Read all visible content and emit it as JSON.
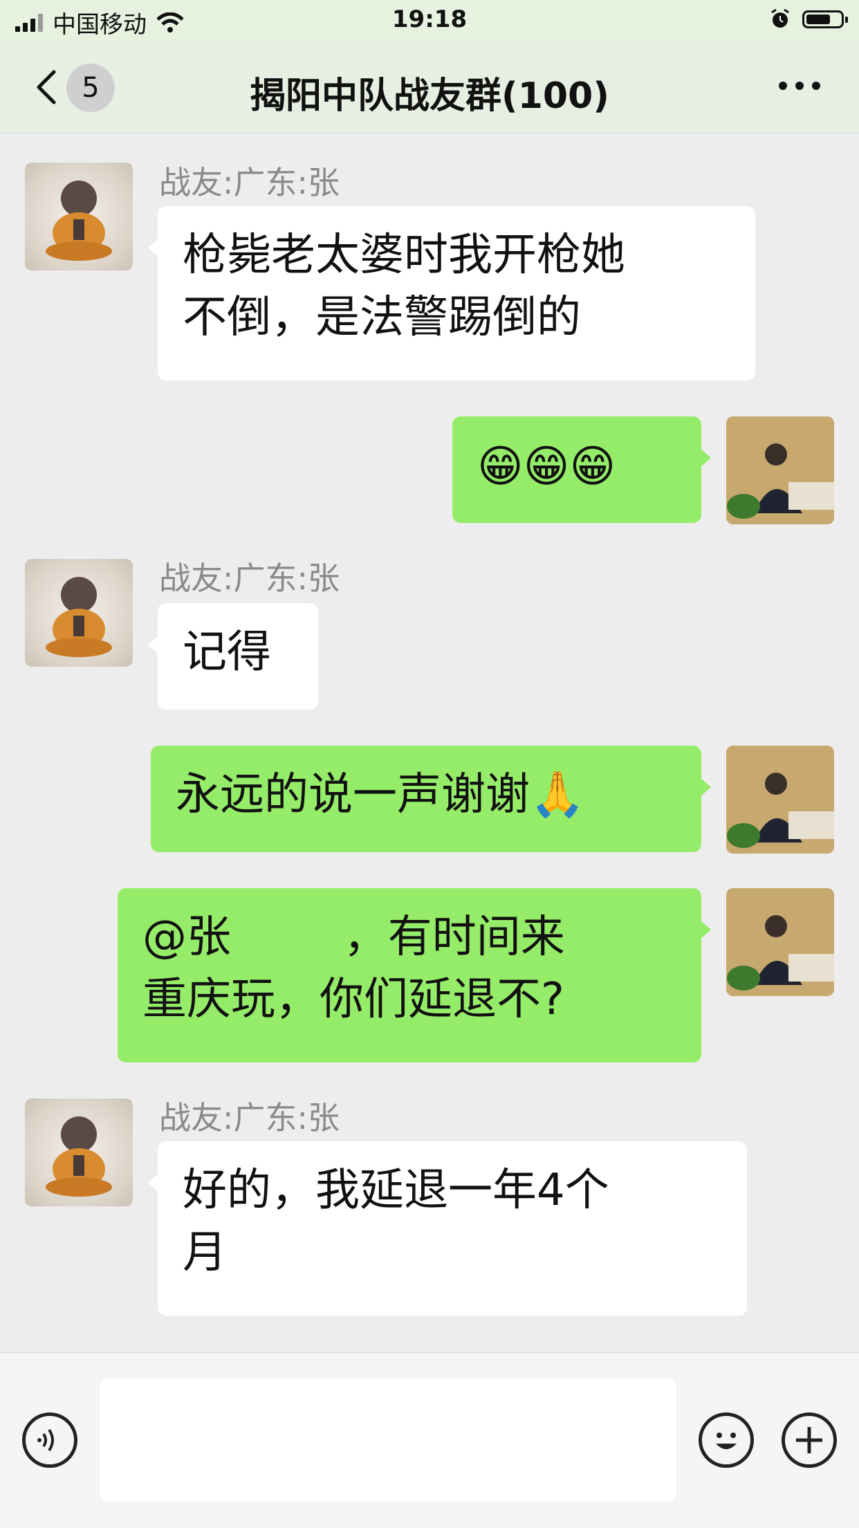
{
  "status_bar": {
    "carrier": "中国移动",
    "time": "19:18"
  },
  "nav": {
    "back_count": "5",
    "title": "揭阳中队战友群(100)"
  },
  "messages": [
    {
      "sender": "战友:广东:张",
      "text": "枪毙老太婆时我开枪她\n不倒，是法警踢倒的"
    },
    {
      "text": "😁😁😁"
    },
    {
      "sender": "战友:广东:张",
      "text": "记得"
    },
    {
      "text": "永远的说一声谢谢🙏"
    },
    {
      "text": "@张        ，有时间来\n重庆玩，你们延退不?"
    },
    {
      "sender": "战友:广东:张",
      "text": "好的，我延退一年4个\n月"
    }
  ],
  "input": {
    "value": ""
  }
}
